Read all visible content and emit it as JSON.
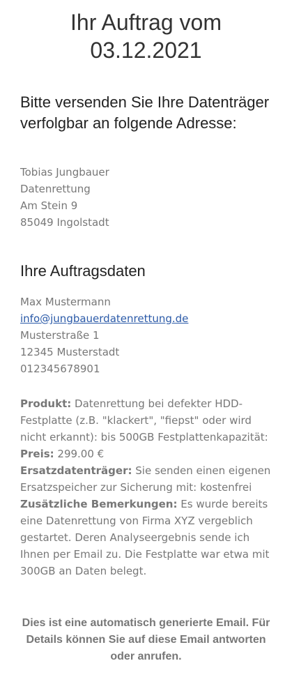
{
  "header": {
    "title_line1": "Ihr Auftrag vom",
    "title_line2": "03.12.2021"
  },
  "shipping": {
    "heading_line1": "Bitte versenden Sie Ihre Datenträger",
    "heading_line2": "verfolgbar an folgende Adresse:",
    "name": "Tobias Jungbauer",
    "company": "Datenrettung",
    "street": "Am Stein 9",
    "city": "85049 Ingolstadt"
  },
  "order": {
    "heading": "Ihre Auftragsdaten",
    "customer_name": "Max Mustermann",
    "email": "info@jungbauerdatenrettung.de",
    "street": "Musterstraße 1",
    "city": "12345 Musterstadt",
    "phone": "012345678901",
    "product_label": "Produkt:",
    "product_value": " Datenrettung bei defekter HDD-Festplatte (z.B. \"klackert\", \"fiepst\" oder wird nicht erkannt): bis 500GB Festplattenkapazität:",
    "price_label": "Preis:",
    "price_value": " 299.00 €",
    "replacement_label": "Ersatzdatenträger:",
    "replacement_value": " Sie senden einen eigenen Ersatzspeicher zur Sicherung mit: kostenfrei",
    "remarks_label": "Zusätzliche Bemerkungen:",
    "remarks_value": " Es wurde bereits eine Datenrettung von Firma XYZ vergeblich gestartet. Deren Analyseergebnis sende ich Ihnen per Email zu. Die Festplatte war etwa mit 300GB an Daten belegt."
  },
  "footer": {
    "text": "Dies ist eine automatisch generierte Email. Für Details können Sie auf diese Email antworten oder anrufen."
  }
}
